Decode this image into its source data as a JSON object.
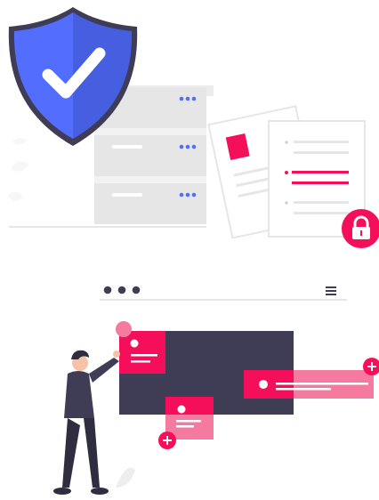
{
  "illustration": {
    "top_panel": {
      "shield_icon": "shield-check-icon",
      "server_rack": {
        "rows": 3,
        "indicator": "•••"
      },
      "documents_icon": "documents-icon",
      "lock_badge_icon": "lock-icon"
    },
    "bottom_panel": {
      "browser_dots": "•••",
      "menu_icon": "hamburger-menu-icon",
      "add_icons": [
        "plus-icon",
        "plus-icon"
      ],
      "person": "person-illustration"
    },
    "colors": {
      "shield_blue": "#536DFE",
      "shield_dark": "#3D52C7",
      "accent_pink": "#F50F5A",
      "accent_pink_light": "#F47AA0",
      "dark_panel": "#3F3D56",
      "light_gray": "#E6E6E6",
      "mid_gray": "#CCCCCC"
    }
  }
}
